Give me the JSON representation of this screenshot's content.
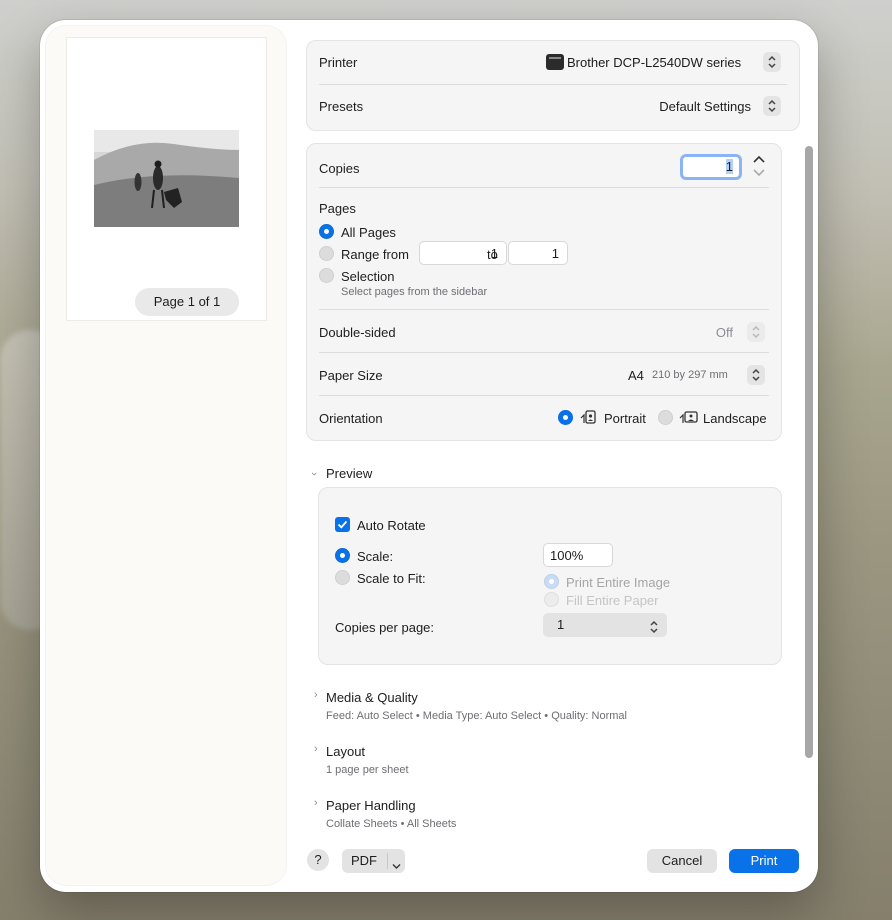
{
  "preview": {
    "page_label": "Page 1 of 1"
  },
  "printer": {
    "label": "Printer",
    "value": "Brother DCP-L2540DW series",
    "icon": "printer-icon",
    "presets_label": "Presets",
    "presets_value": "Default Settings"
  },
  "copies": {
    "label": "Copies",
    "value": "1"
  },
  "pages": {
    "label": "Pages",
    "all_pages": "All Pages",
    "range_from": "Range from",
    "range_start": "1",
    "range_to": "to",
    "range_end": "1",
    "selection": "Selection",
    "selection_hint": "Select pages from the sidebar",
    "selected": "All Pages"
  },
  "double_sided": {
    "label": "Double-sided",
    "value": "Off"
  },
  "paper_size": {
    "label": "Paper Size",
    "value": "A4",
    "detail": "210 by 297 mm"
  },
  "orientation": {
    "label": "Orientation",
    "portrait": "Portrait",
    "landscape": "Landscape",
    "selected": "Portrait"
  },
  "preview_section": {
    "title": "Preview",
    "auto_rotate": "Auto Rotate",
    "auto_rotate_checked": true,
    "scale_label": "Scale:",
    "scale_value": "100%",
    "scale_to_fit": "Scale to Fit:",
    "print_entire_image": "Print Entire Image",
    "fill_entire_paper": "Fill Entire Paper",
    "copies_per_page_label": "Copies per page:",
    "copies_per_page_value": "1"
  },
  "sections": [
    {
      "title": "Media & Quality",
      "summary": "Feed: Auto Select • Media Type: Auto Select • Quality: Normal"
    },
    {
      "title": "Layout",
      "summary": "1 page per sheet"
    },
    {
      "title": "Paper Handling",
      "summary": "Collate Sheets • All Sheets"
    }
  ],
  "footer": {
    "help": "?",
    "pdf": "PDF",
    "cancel": "Cancel",
    "print": "Print"
  },
  "colors": {
    "accent": "#0a72e8"
  }
}
